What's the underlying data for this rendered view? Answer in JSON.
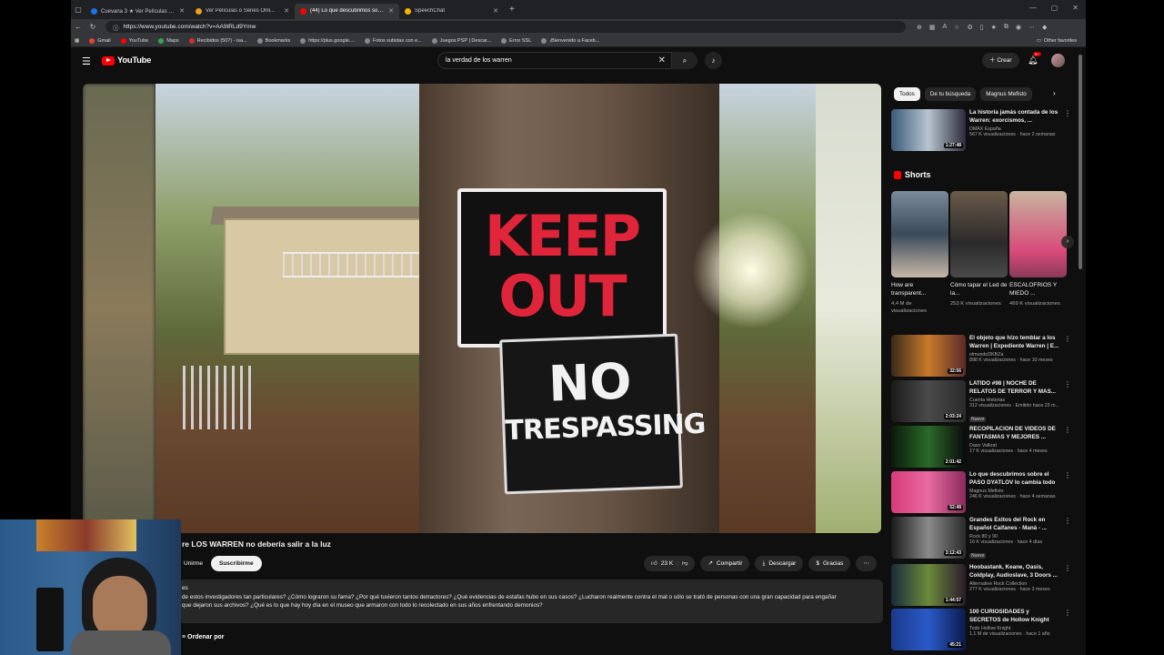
{
  "browser": {
    "tabs": [
      {
        "title": "Cuevana 3 ★ Ver Películas o Se...",
        "color": "#1a73e8",
        "active": false
      },
      {
        "title": "Ver Películas o Series Onli...",
        "color": "#e8a21a",
        "active": false
      },
      {
        "title": "(44) Lo que descubrimos sob...",
        "color": "#ff0000",
        "active": true
      },
      {
        "title": "SpeechChat",
        "color": "#f4b400",
        "active": false
      }
    ],
    "new_tab": "+",
    "url": "https://www.youtube.com/watch?v=AA9tRLd9Ymw",
    "bookmarks": [
      "Gmail",
      "YouTube",
      "Maps",
      "Recibidos (507) - isa...",
      "Bookmarks",
      "https://plus.google....",
      "Fotos subidas con e...",
      "Juegos PSP | Descar...",
      "Error SSL",
      "¡Bienvenido a Faceb..."
    ],
    "other_favorites": "Other favorites"
  },
  "youtube": {
    "logo": "YouTube",
    "search_query": "la verdad de los warren",
    "create_label": "Crear",
    "notif_badge": "9+"
  },
  "video": {
    "sign_keep": "KEEP",
    "sign_out": "OUT",
    "sign_no": "NO",
    "sign_trespassing": "TRESPASSING",
    "title": "re LOS WARREN no debería salir a la luz",
    "join_label": "Unirme",
    "subscribe_label": "Suscribirme",
    "likes": "23 K",
    "share_label": "Compartir",
    "download_label": "Descargar",
    "thanks_label": "Gracias",
    "desc_line1": "es",
    "desc_line2": "de estos investigadores tan particulares? ¿Cómo lograron su fama? ¿Por qué tuvieron tantos detractores? ¿Qué evidencias de estafas hubo en sus casos? ¿Lucharon realmente contra el mal o sólo se trató de personas con una gran capacidad para engañar",
    "desc_line3": "que dejaron sus archivos? ¿Qué es lo que hay hoy día en el museo que armaron con todo lo recolectado en sus años enfrentando demonios?",
    "order_label": "Ordenar por"
  },
  "sidebar": {
    "chips": [
      "Todos",
      "De tu búsqueda",
      "Magnus Mefisto"
    ],
    "top": {
      "title": "La historia jamás contada de los Warren: exorcismos, ...",
      "channel": "DMAX España",
      "stats": "567 K visualizaciones · hace 2 semanas",
      "duration": "1:27:48"
    },
    "shorts_label": "Shorts",
    "shorts": [
      {
        "title": "How are transparent...",
        "views": "4,4 M de visualizaciones"
      },
      {
        "title": "Cómo tapar el Led de la...",
        "views": "253 K visualizaciones"
      },
      {
        "title": "ESCALOFRIOS Y MIEDO ...",
        "views": "469 K visualizaciones"
      }
    ],
    "videos": [
      {
        "title": "El objeto que hizo temblar a los Warren | Expediente Warren | E...",
        "channel": "elmundoDKBZa",
        "stats": "898 K visualizaciones · hace 10 meses",
        "duration": "32:56",
        "new": ""
      },
      {
        "title": "LATIDO #98 | NOCHE DE RELATOS DE TERROR Y MAS...",
        "channel": "Cuenta Historias",
        "stats": "312 visualizaciones · Emitido hace 23 m...",
        "duration": "2:03:24",
        "new": "Nuevo"
      },
      {
        "title": "RECOPILACIÓN DE VIDEOS DE FANTASMAS Y MEJORES ...",
        "channel": "Davo Valkrat",
        "stats": "17 K visualizaciones · hace 4 meses",
        "duration": "2:01:42",
        "new": ""
      },
      {
        "title": "Lo que descubrimos sobre el PASO DYATLOV lo cambia todo",
        "channel": "Magnus Mefisto",
        "stats": "246 K visualizaciones · hace 4 semanas",
        "duration": "52:48",
        "new": ""
      },
      {
        "title": "Grandes Éxitos del Rock en Español Caifanes - Maná - ...",
        "channel": "Rock 80 y 90",
        "stats": "16 K visualizaciones · hace 4 días",
        "duration": "3:12:43",
        "new": "Nuevo"
      },
      {
        "title": "Hoobastank, Keane, Oasis, Coldplay, Audioslave, 3 Doors ...",
        "channel": "Alternative Rock Collection",
        "stats": "277 K visualizaciones · hace 3 meses",
        "duration": "1:44:57",
        "new": ""
      },
      {
        "title": "100 CURIOSIDADES y SECRETOS de Hollow Knight",
        "channel": "Todo Hollow Knight",
        "stats": "1,1 M de visualizaciones · hace 1 año",
        "duration": "45:21",
        "new": ""
      }
    ]
  },
  "colors": {
    "yt_red": "#ff0000",
    "bg": "#0f0f0f",
    "sign_red": "#e0243a"
  }
}
